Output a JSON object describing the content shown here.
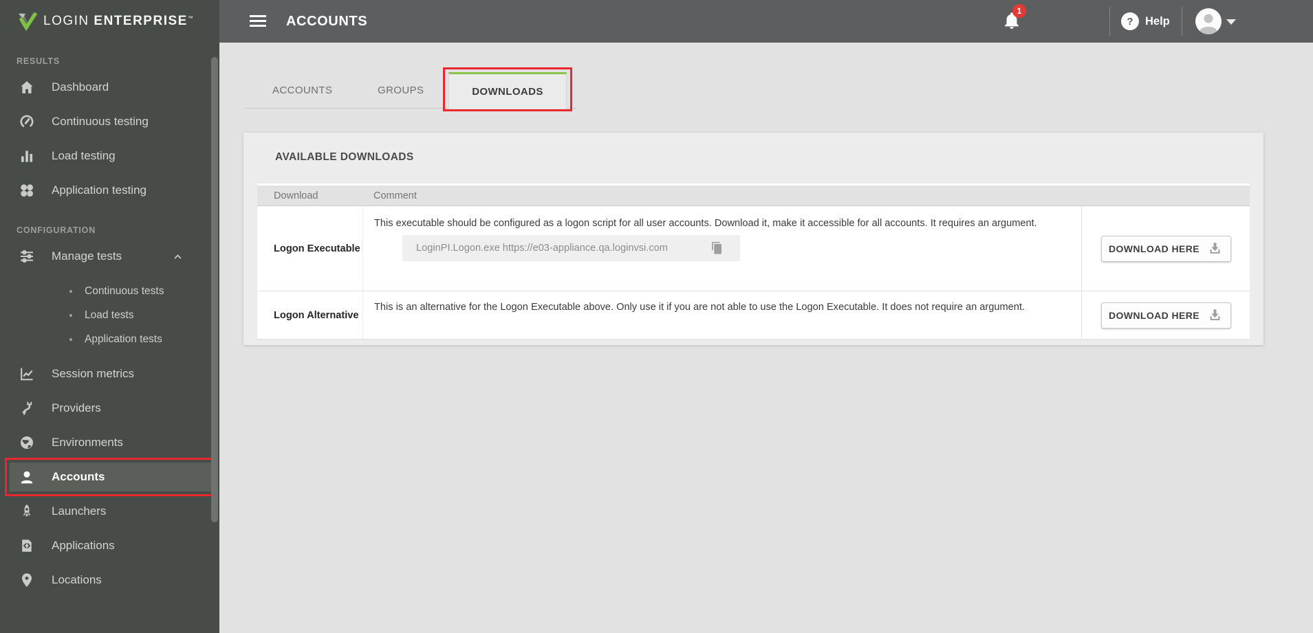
{
  "brand": {
    "word1": "LOGIN",
    "word2": "ENTERPRISE",
    "tm": "™"
  },
  "topbar": {
    "title": "ACCOUNTS",
    "notification_count": "1",
    "help_icon_glyph": "?",
    "help_label": "Help"
  },
  "sidebar": {
    "sections": [
      {
        "label": "RESULTS",
        "items": [
          {
            "label": "Dashboard",
            "icon": "home-icon"
          },
          {
            "label": "Continuous testing",
            "icon": "gauge-icon"
          },
          {
            "label": "Load testing",
            "icon": "bar-chart-icon"
          },
          {
            "label": "Application testing",
            "icon": "apps-icon"
          }
        ]
      },
      {
        "label": "CONFIGURATION",
        "items": [
          {
            "label": "Manage tests",
            "icon": "tune-icon",
            "expanded": true,
            "children": [
              "Continuous tests",
              "Load tests",
              "Application tests"
            ]
          },
          {
            "label": "Session metrics",
            "icon": "line-chart-icon"
          },
          {
            "label": "Providers",
            "icon": "cable-icon"
          },
          {
            "label": "Environments",
            "icon": "globe-icon"
          },
          {
            "label": "Accounts",
            "icon": "person-icon",
            "selected": true,
            "annotated": true
          },
          {
            "label": "Launchers",
            "icon": "rocket-icon"
          },
          {
            "label": "Applications",
            "icon": "code-file-icon"
          },
          {
            "label": "Locations",
            "icon": "map-pin-icon"
          }
        ]
      }
    ]
  },
  "tabs": [
    {
      "label": "ACCOUNTS",
      "active": false
    },
    {
      "label": "GROUPS",
      "active": false
    },
    {
      "label": "DOWNLOADS",
      "active": true,
      "annotated": true
    }
  ],
  "panel": {
    "title": "AVAILABLE DOWNLOADS",
    "columns": [
      "Download",
      "Comment"
    ],
    "rows": [
      {
        "name": "Logon Executable",
        "comment": "This executable should be configured as a logon script for all user accounts. Download it, make it accessible for all accounts. It requires an argument.",
        "command": "LoginPI.Logon.exe https://e03-appliance.qa.loginvsi.com",
        "button_label": "DOWNLOAD HERE"
      },
      {
        "name": "Logon Alternative",
        "comment": "This is an alternative for the Logon Executable above. Only use it if you are not able to use the Logon Executable. It does not require an argument.",
        "button_label": "DOWNLOAD HERE"
      }
    ]
  },
  "colors": {
    "accent_green": "#8bc34a",
    "annotation_red": "#e8282e",
    "notification_red": "#e53935",
    "logo_green": "#7dc242",
    "sidebar_bg": "#484c48",
    "topbar_bg": "#5d5e5f"
  }
}
